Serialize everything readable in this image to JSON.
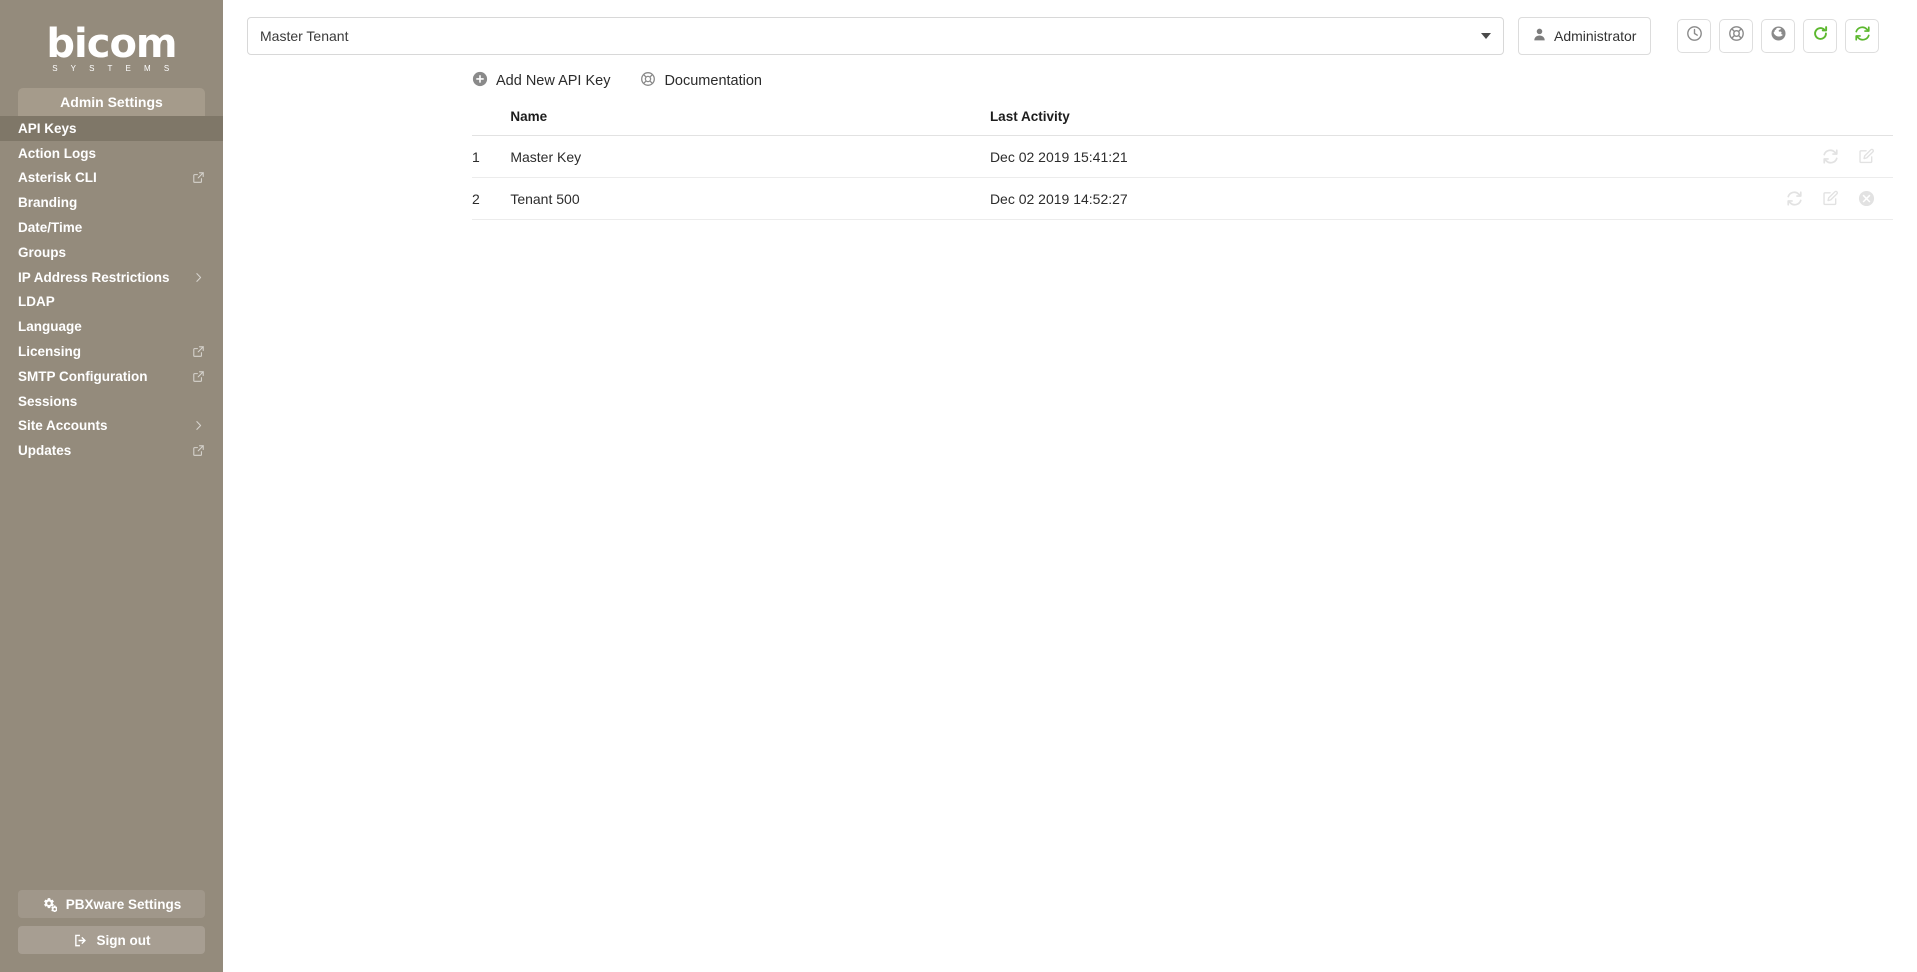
{
  "brand": {
    "logo_text": "bicom",
    "logo_subtext": "S Y S T E M S"
  },
  "sidebar": {
    "tab_label": "Admin Settings",
    "items": [
      {
        "label": "API Keys",
        "active": true,
        "trail": "none"
      },
      {
        "label": "Action Logs",
        "active": false,
        "trail": "none"
      },
      {
        "label": "Asterisk CLI",
        "active": false,
        "trail": "external-link-icon"
      },
      {
        "label": "Branding",
        "active": false,
        "trail": "none"
      },
      {
        "label": "Date/Time",
        "active": false,
        "trail": "none"
      },
      {
        "label": "Groups",
        "active": false,
        "trail": "none"
      },
      {
        "label": "IP Address Restrictions",
        "active": false,
        "trail": "chevron-right-icon"
      },
      {
        "label": "LDAP",
        "active": false,
        "trail": "none"
      },
      {
        "label": "Language",
        "active": false,
        "trail": "none"
      },
      {
        "label": "Licensing",
        "active": false,
        "trail": "external-link-icon"
      },
      {
        "label": "SMTP Configuration",
        "active": false,
        "trail": "external-link-icon"
      },
      {
        "label": "Sessions",
        "active": false,
        "trail": "none"
      },
      {
        "label": "Site Accounts",
        "active": false,
        "trail": "chevron-right-icon"
      },
      {
        "label": "Updates",
        "active": false,
        "trail": "external-link-icon"
      }
    ],
    "bottom_buttons": [
      {
        "label": "PBXware Settings",
        "icon": "gears-icon"
      },
      {
        "label": "Sign out",
        "icon": "sign-out-icon"
      }
    ]
  },
  "topbar": {
    "tenant_value": "Master Tenant",
    "tenant_placeholder": "Master Tenant",
    "admin_label": "Administrator",
    "admin_icon": "user-icon",
    "icon_buttons": [
      {
        "icon": "clock-icon",
        "color": "#8a8a8a"
      },
      {
        "icon": "lifering-icon",
        "color": "#8a8a8a"
      },
      {
        "icon": "globe-icon",
        "color": "#8a8a8a"
      },
      {
        "icon": "refresh-icon",
        "color": "#5cb82e"
      },
      {
        "icon": "sync-icon",
        "color": "#5cb82e"
      }
    ]
  },
  "actions": [
    {
      "label": "Add New API Key",
      "icon": "plus-circle-icon"
    },
    {
      "label": "Documentation",
      "icon": "lifering-icon"
    }
  ],
  "table": {
    "columns": [
      "",
      "Name",
      "Last Activity",
      ""
    ],
    "rows": [
      {
        "index": "1",
        "name": "Master Key",
        "last_activity": "Dec 02 2019 15:41:21",
        "ops": [
          "sync-icon",
          "edit-icon"
        ]
      },
      {
        "index": "2",
        "name": "Tenant 500",
        "last_activity": "Dec 02 2019 14:52:27",
        "ops": [
          "sync-icon",
          "edit-icon",
          "delete-icon"
        ]
      }
    ]
  },
  "colors": {
    "sidebar_bg": "#948b7c",
    "sidebar_active": "#7f7768",
    "sidebar_tab": "#a59b8b",
    "accent_green": "#5cb82e",
    "icon_gray": "#8a8a8a",
    "row_icon_gray": "#e2e2e2"
  }
}
